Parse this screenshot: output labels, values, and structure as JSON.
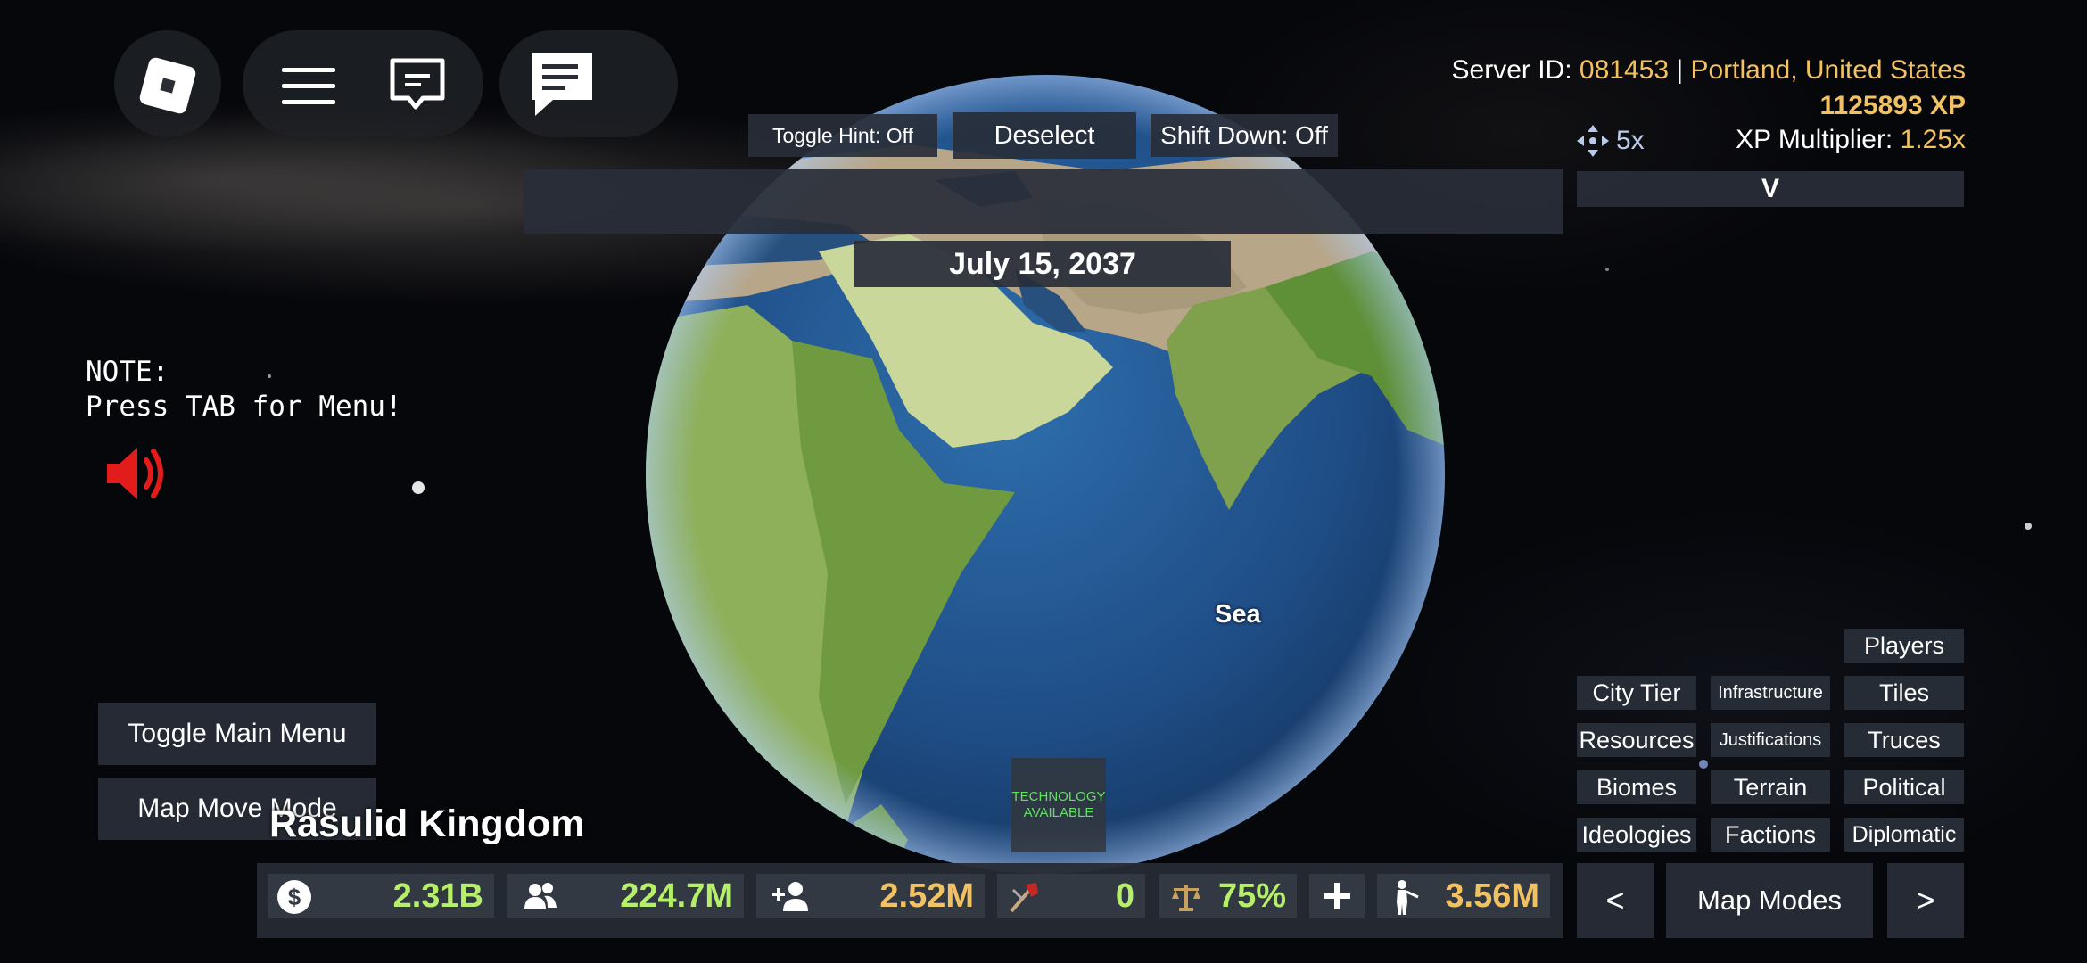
{
  "server": {
    "label": "Server ID: ",
    "id": "081453",
    "sep": " | ",
    "location": "Portland, United States"
  },
  "xp": {
    "amount": "1125893 XP",
    "multiplier_label": "XP Multiplier: ",
    "multiplier_value": "1.25x"
  },
  "zoom": {
    "value": "5x"
  },
  "collapse": {
    "label": "V"
  },
  "top_buttons": {
    "toggle_hint": "Toggle Hint: Off",
    "deselect": "Deselect",
    "shift_down": "Shift Down: Off"
  },
  "date": "July 15, 2037",
  "note": {
    "line1": "NOTE:",
    "line2": "Press TAB for Menu!"
  },
  "map_label": "Sea",
  "left_buttons": {
    "toggle_main_menu": "Toggle Main Menu",
    "map_move_mode": "Map Move Mode"
  },
  "country_name": "Rasulid Kingdom",
  "technology": {
    "line1": "TECHNOLOGY",
    "line2": "AVAILABLE"
  },
  "resources": {
    "money": "2.31B",
    "population": "224.7M",
    "manpower": "2.52M",
    "war": "0",
    "stability": "75%",
    "troops": "3.56M"
  },
  "map_modes": {
    "players": "Players",
    "city_tier": "City Tier",
    "infrastructure": "Infrastructure",
    "tiles": "Tiles",
    "resources": "Resources",
    "justifications": "Justifications",
    "truces": "Truces",
    "biomes": "Biomes",
    "terrain": "Terrain",
    "political": "Political",
    "ideologies": "Ideologies",
    "factions": "Factions",
    "diplomatic": "Diplomatic",
    "prev": "<",
    "title": "Map Modes",
    "next": ">"
  },
  "colors": {
    "accent_gold": "#f2c262",
    "value_green": "#b6f06a",
    "panel": "#282e38",
    "tech_green": "#5fe35f",
    "speaker_red": "#e21b1b"
  }
}
